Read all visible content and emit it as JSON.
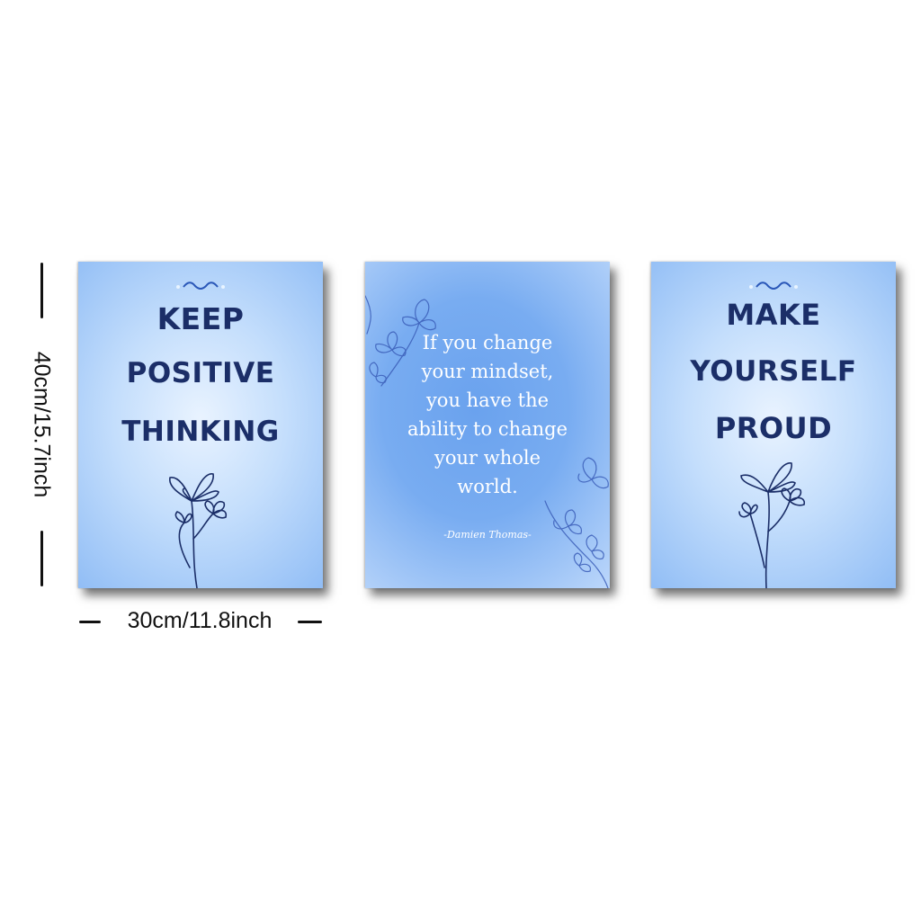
{
  "dimensions": {
    "height_label": "40cm/15.7inch",
    "width_label": "30cm/11.8inch"
  },
  "posters": [
    {
      "lines": [
        "KEEP",
        "POSITIVE",
        "THINKING"
      ]
    },
    {
      "quote_lines": [
        "If you change",
        "your mindset,",
        "you have the",
        "ability to change",
        "your whole",
        "world."
      ],
      "author": "-Damien Thomas-"
    },
    {
      "lines": [
        "MAKE",
        "YOURSELF",
        "PROUD"
      ]
    }
  ],
  "colors": {
    "headline": "#1b2e68",
    "quote_text": "#ffffff",
    "background": "#ffffff"
  }
}
